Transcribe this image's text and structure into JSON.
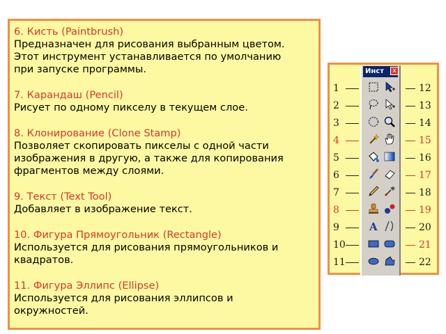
{
  "sections": [
    {
      "title": "6. Кисть (Paintbrush)",
      "lines": [
        "Предназначен для рисования выбранным цветом.",
        "Этот инструмент устанавливается по умолчанию",
        "при запуске программы."
      ]
    },
    {
      "title": "7. Карандаш (Pencil)",
      "lines": [
        "Рисует по одному пикселу в текущем слое."
      ]
    },
    {
      "title": "8. Клонирование (Clone Stamp)",
      "lines": [
        "Позволяет скопировать пикселы с одной части",
        "изображения в другую, а также для копирования",
        "фрагментов между слоями."
      ]
    },
    {
      "title": "9. Текст (Text Tool)",
      "lines": [
        "Добавляет в изображение текст."
      ]
    },
    {
      "title": "10. Фигура Прямоугольник (Rectangle)",
      "lines": [
        "Используется для рисования прямоугольников и",
        "квадратов."
      ]
    },
    {
      "title": "11. Фигура Эллипс (Ellipse)",
      "lines": [
        "Используется для рисования эллипсов и",
        "окружностей."
      ]
    }
  ],
  "toolbox": {
    "title": "Инст",
    "close": "x"
  },
  "left_numbers": [
    "1",
    "2",
    "3",
    "4",
    "5",
    "6",
    "7",
    "8",
    "9",
    "10",
    "11"
  ],
  "right_numbers": [
    "12",
    "13",
    "14",
    "15",
    "16",
    "17",
    "18",
    "19",
    "20",
    "21",
    "22"
  ],
  "highlight_colors": {
    "accent": "#d6372a",
    "border": "#f08f43",
    "panel": "#fdf9a3"
  },
  "tools_left": [
    "rect-select-icon",
    "lasso-icon",
    "ellipse-select-icon",
    "magic-wand-icon",
    "paint-bucket-icon",
    "paintbrush-icon",
    "pencil-icon",
    "clone-stamp-icon",
    "text-icon",
    "rectangle-shape-icon",
    "ellipse-shape-icon"
  ],
  "tools_right": [
    "move-pointer-icon",
    "direct-select-icon",
    "zoom-icon",
    "pan-hand-icon",
    "gradient-icon",
    "eraser-icon",
    "color-picker-icon",
    "recolor-icon",
    "line-curve-icon",
    "rounded-rect-icon",
    "freeform-shape-icon"
  ]
}
